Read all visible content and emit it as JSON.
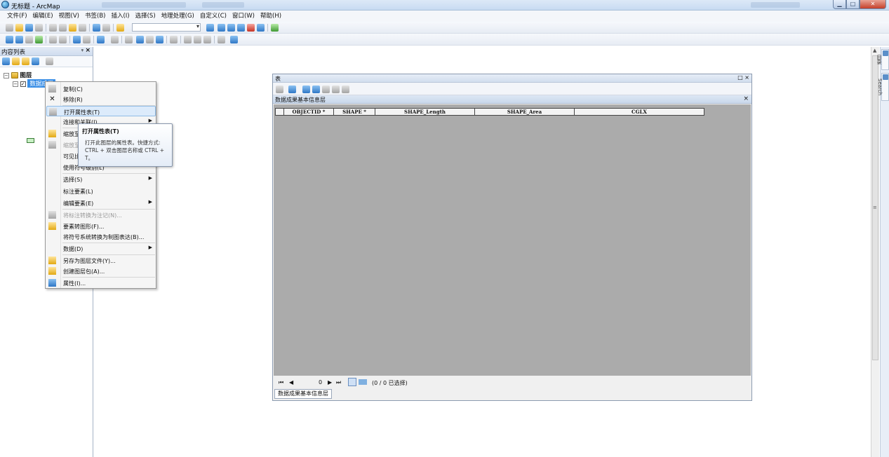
{
  "window": {
    "title": "无标题 - ArcMap"
  },
  "menu": [
    "文件(F)",
    "编辑(E)",
    "视图(V)",
    "书签(B)",
    "插入(I)",
    "选择(S)",
    "地理处理(G)",
    "自定义(C)",
    "窗口(W)",
    "帮助(H)"
  ],
  "toc": {
    "title": "内容列表",
    "pin": "ᵠ",
    "close": "×",
    "root_label": "图层",
    "layer_label": "数据成果"
  },
  "context_menu": {
    "items": [
      {
        "label": "复制(C)",
        "icon": "copy-icon"
      },
      {
        "label": "移除(R)",
        "icon": "remove-icon"
      },
      {
        "label": "打开属性表(T)",
        "icon": "table-icon",
        "highlighted": true
      },
      {
        "label": "连接和关联(J)",
        "icon": "join-icon",
        "submenu": true
      },
      {
        "label": "缩放至图层(Z)",
        "icon": "zoom-layer-icon"
      },
      {
        "label": "缩放至可见(M)",
        "icon": "zoom-visible-icon",
        "disabled": true
      },
      {
        "label": "可见比例范围(S)",
        "icon": "scale-icon"
      },
      {
        "label": "使用符号级别(L)",
        "icon": "symbol-level-icon"
      },
      {
        "label": "选择(S)",
        "icon": "select-icon",
        "submenu": true
      },
      {
        "label": "标注要素(L)",
        "icon": "label-icon"
      },
      {
        "label": "编辑要素(E)",
        "icon": "edit-icon",
        "submenu": true
      },
      {
        "label": "将标注转换为注记(N)...",
        "icon": "convert-annotation-icon",
        "disabled": true
      },
      {
        "label": "要素转图形(F)...",
        "icon": "feature-to-graphic-icon"
      },
      {
        "label": "将符号系统转换为制图表达(B)...",
        "icon": "representation-icon"
      },
      {
        "label": "数据(D)",
        "icon": "data-icon",
        "submenu": true
      },
      {
        "label": "另存为图层文件(Y)...",
        "icon": "layer-file-icon"
      },
      {
        "label": "创建图层包(A)...",
        "icon": "layer-package-icon"
      },
      {
        "label": "属性(I)...",
        "icon": "properties-icon"
      }
    ]
  },
  "tooltip": {
    "title": "打开属性表(T)",
    "description": "打开此图层的属性表。快捷方式: CTRL + 双击图层名称或 CTRL + T。"
  },
  "table_window": {
    "title": "表",
    "controls": "□ ×",
    "layer_tab": "数据成果基本信息层",
    "close": "×",
    "columns": [
      "OBJECTID *",
      "SHAPE *",
      "SHAPE_Length",
      "SHAPE_Area",
      "CGLX"
    ],
    "nav": {
      "first": "⏮",
      "prev": "◀",
      "record": "0",
      "next": "▶",
      "last": "⏭",
      "selection": "(0 / 0 已选择)"
    },
    "bottom_tab": "数据成果基本信息层"
  },
  "side_tabs": [
    "目录",
    "Search"
  ]
}
